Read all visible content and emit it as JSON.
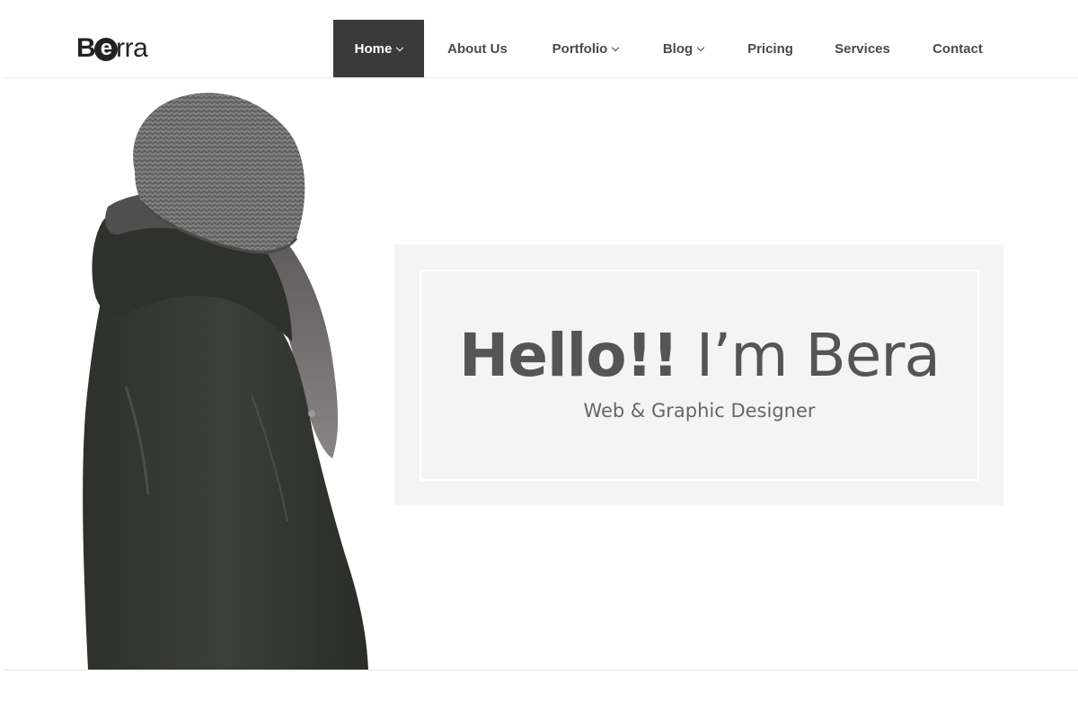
{
  "brand": {
    "logo_prefix": "B",
    "logo_circle_letter": "e",
    "logo_suffix": "rra",
    "accent_color": "#3a3a3a"
  },
  "nav": {
    "items": [
      {
        "label": "Home",
        "has_dropdown": true,
        "active": true
      },
      {
        "label": "About Us",
        "has_dropdown": false,
        "active": false
      },
      {
        "label": "Portfolio",
        "has_dropdown": true,
        "active": false
      },
      {
        "label": "Blog",
        "has_dropdown": true,
        "active": false
      },
      {
        "label": "Pricing",
        "has_dropdown": false,
        "active": false
      },
      {
        "label": "Services",
        "has_dropdown": false,
        "active": false
      },
      {
        "label": "Contact",
        "has_dropdown": false,
        "active": false
      }
    ]
  },
  "hero": {
    "greeting_bold": "Hello!!",
    "greeting_rest": " I’m Bera",
    "subtitle": "Web & Graphic Designer",
    "panel_color": "#f4f4f4"
  }
}
